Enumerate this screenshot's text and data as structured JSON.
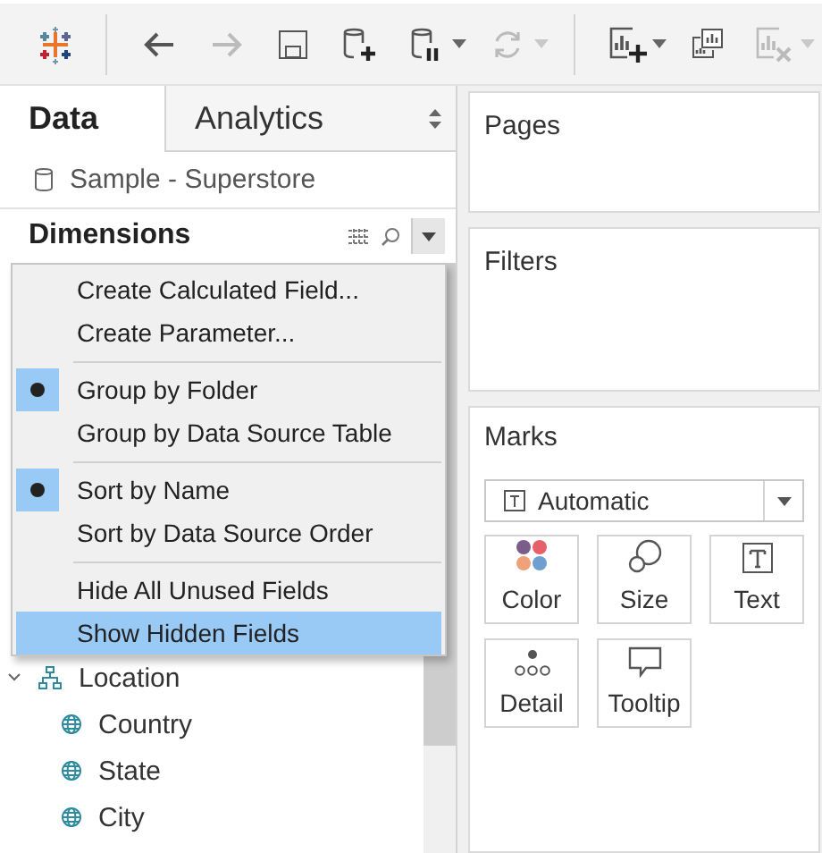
{
  "toolbar": {
    "buttons": [
      {
        "kind": "logo",
        "disabled": false,
        "has_menu": false
      },
      {
        "kind": "back",
        "disabled": false,
        "has_menu": false
      },
      {
        "kind": "forward",
        "disabled": true,
        "has_menu": false
      },
      {
        "kind": "save",
        "disabled": false,
        "has_menu": false
      },
      {
        "kind": "new-data-source",
        "disabled": false,
        "has_menu": false
      },
      {
        "kind": "pause",
        "disabled": false,
        "has_menu": true
      },
      {
        "kind": "refresh",
        "disabled": true,
        "has_menu": true
      },
      {
        "kind": "new-worksheet",
        "disabled": false,
        "has_menu": true
      },
      {
        "kind": "duplicate",
        "disabled": false,
        "has_menu": false
      },
      {
        "kind": "clear",
        "disabled": true,
        "has_menu": true
      }
    ]
  },
  "data_pane": {
    "tabs": [
      {
        "label": "Data",
        "selected": true
      },
      {
        "label": "Analytics",
        "selected": false
      }
    ],
    "data_source": "Sample - Superstore",
    "section_title": "Dimensions",
    "tree": [
      {
        "label": "Location",
        "kind": "hierarchy",
        "expanded": true,
        "children": [
          {
            "label": "Country",
            "kind": "geo"
          },
          {
            "label": "State",
            "kind": "geo"
          },
          {
            "label": "City",
            "kind": "geo"
          }
        ]
      }
    ]
  },
  "context_menu": {
    "groups": [
      [
        {
          "label": "Create Calculated Field...",
          "checked": false,
          "selected": false
        },
        {
          "label": "Create Parameter...",
          "checked": false,
          "selected": false
        }
      ],
      [
        {
          "label": "Group by Folder",
          "checked": true,
          "selected": false
        },
        {
          "label": "Group by Data Source Table",
          "checked": false,
          "selected": false
        }
      ],
      [
        {
          "label": "Sort by Name",
          "checked": true,
          "selected": false
        },
        {
          "label": "Sort by Data Source Order",
          "checked": false,
          "selected": false
        }
      ],
      [
        {
          "label": "Hide All Unused Fields",
          "checked": false,
          "selected": false
        },
        {
          "label": "Show Hidden Fields",
          "checked": false,
          "selected": true
        }
      ]
    ]
  },
  "shelves": {
    "pages": "Pages",
    "filters": "Filters",
    "marks": {
      "title": "Marks",
      "mark_type": "Automatic",
      "cards": [
        {
          "label": "Color",
          "kind": "color"
        },
        {
          "label": "Size",
          "kind": "size"
        },
        {
          "label": "Text",
          "kind": "text"
        },
        {
          "label": "Detail",
          "kind": "detail"
        },
        {
          "label": "Tooltip",
          "kind": "tooltip"
        }
      ]
    }
  }
}
